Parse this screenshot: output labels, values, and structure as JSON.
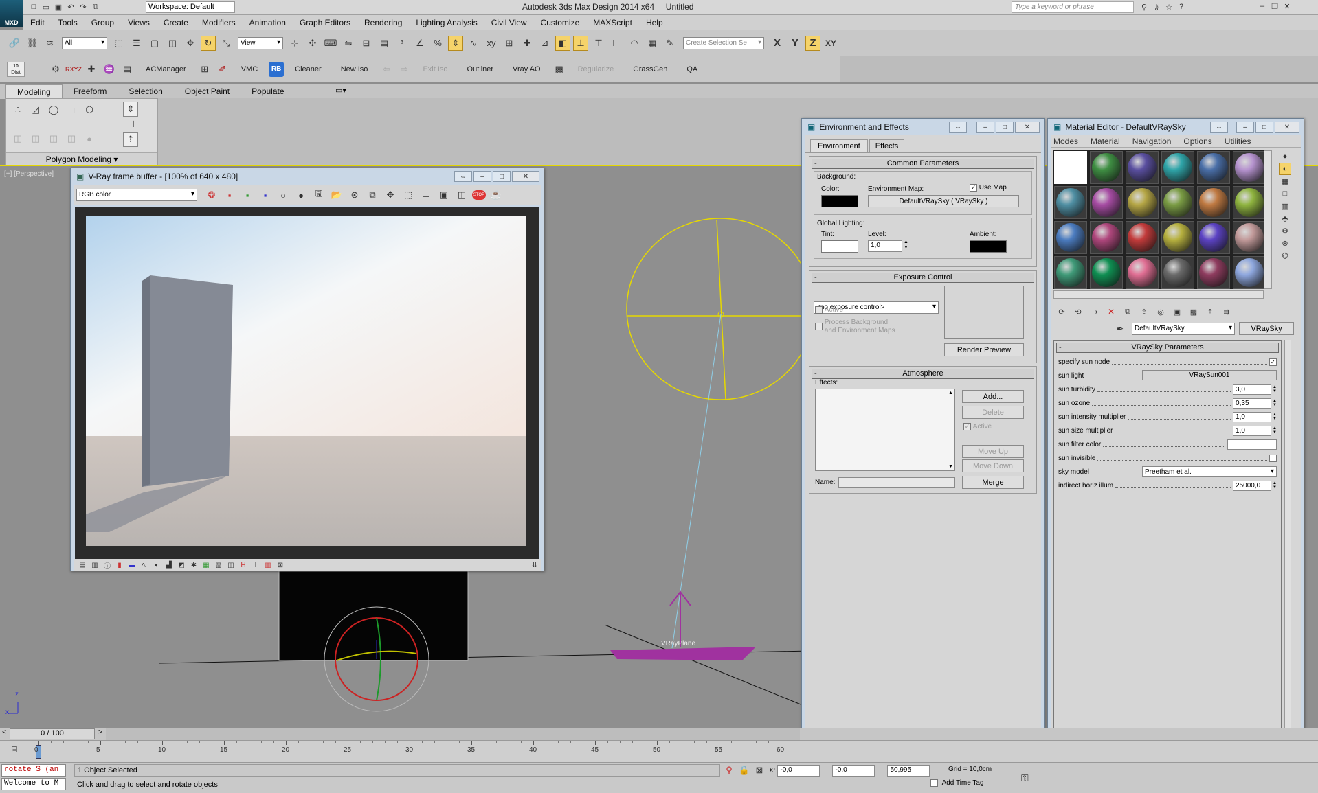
{
  "app": {
    "title": "Autodesk 3ds Max Design 2014 x64",
    "document": "Untitled",
    "workspace": "Workspace: Default",
    "search_placeholder": "Type a keyword or phrase",
    "logo_text": "MXD"
  },
  "menu": [
    "Edit",
    "Tools",
    "Group",
    "Views",
    "Create",
    "Modifiers",
    "Animation",
    "Graph Editors",
    "Rendering",
    "Lighting Analysis",
    "Civil View",
    "Customize",
    "MAXScript",
    "Help"
  ],
  "main_toolbar": {
    "selection_filter": "All",
    "ref_coord": "View",
    "selection_set_placeholder": "Create Selection Se",
    "axes": [
      "X",
      "Y",
      "Z",
      "XY"
    ]
  },
  "second_toolbar": {
    "dist_label": "Dist",
    "rb_label": "RB",
    "items": [
      {
        "label": "ACManager",
        "disabled": false
      },
      {
        "label": "VMC",
        "disabled": false
      },
      {
        "label": "Cleaner",
        "disabled": false
      },
      {
        "label": "New Iso",
        "disabled": false
      },
      {
        "label": "Exit Iso",
        "disabled": true
      },
      {
        "label": "Outliner",
        "disabled": false
      },
      {
        "label": "Vray AO",
        "disabled": false
      },
      {
        "label": "Regularize",
        "disabled": true
      },
      {
        "label": "GrassGen",
        "disabled": false
      },
      {
        "label": "QA",
        "disabled": false
      }
    ]
  },
  "ribbon": {
    "tabs": [
      "Modeling",
      "Freeform",
      "Selection",
      "Object Paint",
      "Populate"
    ],
    "panel_label": "Polygon Modeling"
  },
  "viewport": {
    "label": "[+] [Perspective]",
    "object_label": "VRayPlane"
  },
  "vfb": {
    "title": "V-Ray frame buffer - [100% of 640 x 480]",
    "channel": "RGB color",
    "stop_label": "STOP"
  },
  "env": {
    "title": "Environment and Effects",
    "tabs": [
      "Environment",
      "Effects"
    ],
    "common": {
      "header": "Common Parameters",
      "background": "Background:",
      "color": "Color:",
      "env_map": "Environment Map:",
      "use_map": "Use Map",
      "map_button": "DefaultVRaySky  ( VRaySky )",
      "global_lighting": "Global Lighting:",
      "tint": "Tint:",
      "level": "Level:",
      "level_value": "1,0",
      "ambient": "Ambient:"
    },
    "exposure": {
      "header": "Exposure Control",
      "selected": "<no exposure control>",
      "active": "Active",
      "process_bg": "Process Background",
      "process_bg2": "and Environment Maps",
      "render_preview": "Render Preview"
    },
    "atmosphere": {
      "header": "Atmosphere",
      "effects": "Effects:",
      "add": "Add...",
      "delete": "Delete",
      "active": "Active",
      "move_up": "Move Up",
      "move_down": "Move Down",
      "name": "Name:",
      "merge": "Merge"
    }
  },
  "mat": {
    "title": "Material Editor - DefaultVRaySky",
    "menu": [
      "Modes",
      "Material",
      "Navigation",
      "Options",
      "Utilities"
    ],
    "material_name": "DefaultVRaySky",
    "material_type": "VRaySky",
    "rollout": "VRaySky Parameters",
    "params": [
      {
        "label": "specify sun node",
        "kind": "check",
        "value": "✓"
      },
      {
        "label": "sun light",
        "kind": "button",
        "value": "VRaySun001"
      },
      {
        "label": "sun turbidity",
        "kind": "spin",
        "value": "3,0"
      },
      {
        "label": "sun ozone",
        "kind": "spin",
        "value": "0,35"
      },
      {
        "label": "sun intensity multiplier",
        "kind": "spin",
        "value": "1,0"
      },
      {
        "label": "sun size multiplier",
        "kind": "spin",
        "value": "1,0"
      },
      {
        "label": "sun filter color",
        "kind": "color",
        "value": ""
      },
      {
        "label": "sun invisible",
        "kind": "check",
        "value": ""
      },
      {
        "label": "sky model",
        "kind": "dropdown",
        "value": "Preetham et al."
      },
      {
        "label": "indirect horiz illum",
        "kind": "spin",
        "value": "25000,0"
      }
    ],
    "spheres": [
      "#ffffff",
      "#3f8f43",
      "#5a4fa0",
      "#2fa5a9",
      "#4a6fa8",
      "#b693cf",
      "#4f8fa3",
      "#a64ca3",
      "#b5a645",
      "#7a9c44",
      "#c07a42",
      "#8fb43f",
      "#4b7cc0",
      "#b0477d",
      "#c33b3b",
      "#b7b13f",
      "#5c43c4",
      "#c29a9a",
      "#3f9a78",
      "#0f8f52",
      "#e06e93",
      "#6a6a6a",
      "#8f3c5f",
      "#8ea7de"
    ]
  },
  "timeline": {
    "frame": "0 / 100",
    "ticks": [
      "0",
      "5",
      "10",
      "15",
      "20",
      "25",
      "30",
      "35",
      "40",
      "45",
      "50",
      "55",
      "60"
    ]
  },
  "status": {
    "script_line": "rotate $ (an",
    "welcome": "Welcome to M",
    "selection": "1 Object Selected",
    "prompt": "Click and drag to select and rotate objects",
    "x_label": "X:",
    "x_value": "-0,0",
    "y_value": "-0,0",
    "z_value": "50,995",
    "grid": "Grid = 10,0cm",
    "add_time_tag": "Add Time Tag"
  }
}
